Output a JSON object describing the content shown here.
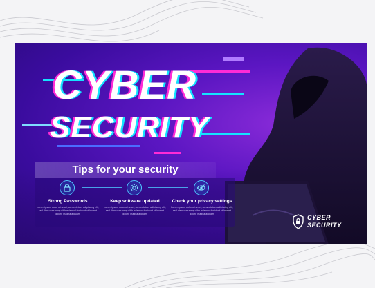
{
  "banner": {
    "title_line1": "CYBER",
    "title_line2": "SECURITY",
    "tips_title": "Tips for your security",
    "tips": [
      {
        "icon": "lock-icon",
        "title": "Strong Passwords",
        "body": "Lorem ipsum dolor sit amet, consectetuer adipiscing elit, sed diam nonummy nibh euismod tincidunt ut laoreet dolore magna aliquam"
      },
      {
        "icon": "gear-icon",
        "title": "Keep software updated",
        "body": "Lorem ipsum dolor sit amet, consectetuer adipiscing elit, sed diam nonummy nibh euismod tincidunt ut laoreet dolore magna aliquam"
      },
      {
        "icon": "eye-icon",
        "title": "Check your privacy settings",
        "body": "Lorem ipsum dolor sit amet, consectetuer adipiscing elit, sed diam nonummy nibh euismod tincidunt ut laoreet dolore magna aliquam"
      }
    ],
    "brand_line1": "CYBER",
    "brand_line2": "SECURITY"
  },
  "colors": {
    "background": "#f4f4f6",
    "banner_purple": "#5b16c2",
    "accent_cyan": "#14e3ff",
    "accent_magenta": "#ff2bd6"
  }
}
